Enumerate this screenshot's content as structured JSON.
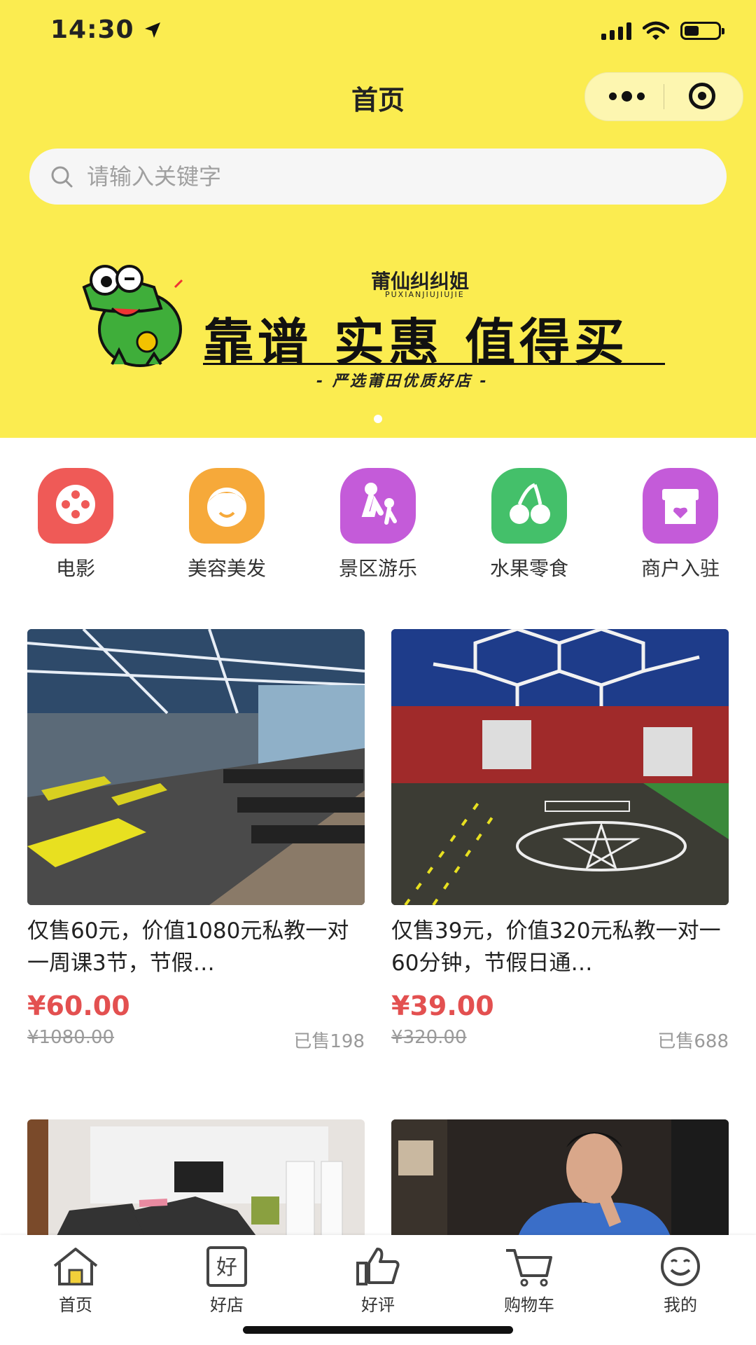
{
  "status": {
    "time": "14:30"
  },
  "header": {
    "title": "首页"
  },
  "search": {
    "placeholder": "请输入关键字"
  },
  "banner": {
    "brand": "莆仙纠纠姐",
    "brand_sub": "PUXIANJIUJIUJIE",
    "slogan": "靠谱 实惠 值得买",
    "tagline": "- 严选莆田优质好店 -"
  },
  "categories": [
    {
      "label": "电影",
      "color": "#ef5a57"
    },
    {
      "label": "美容美发",
      "color": "#f6a93a"
    },
    {
      "label": "景区游乐",
      "color": "#c45bd9"
    },
    {
      "label": "水果零食",
      "color": "#44c06a"
    },
    {
      "label": "商户入驻",
      "color": "#c45bd9"
    }
  ],
  "products": [
    {
      "title": "仅售60元，价值1080元私教一对一周课3节，节假…",
      "price": "¥60.00",
      "original": "¥1080.00",
      "sold": "已售198"
    },
    {
      "title": "仅售39元，价值320元私教一对一60分钟，节假日通…",
      "price": "¥39.00",
      "original": "¥320.00",
      "sold": "已售688"
    }
  ],
  "tabbar": [
    {
      "label": "首页"
    },
    {
      "label": "好店"
    },
    {
      "label": "好评"
    },
    {
      "label": "购物车"
    },
    {
      "label": "我的"
    }
  ],
  "colors": {
    "brand_yellow": "#fbec50",
    "price_red": "#e35050"
  }
}
